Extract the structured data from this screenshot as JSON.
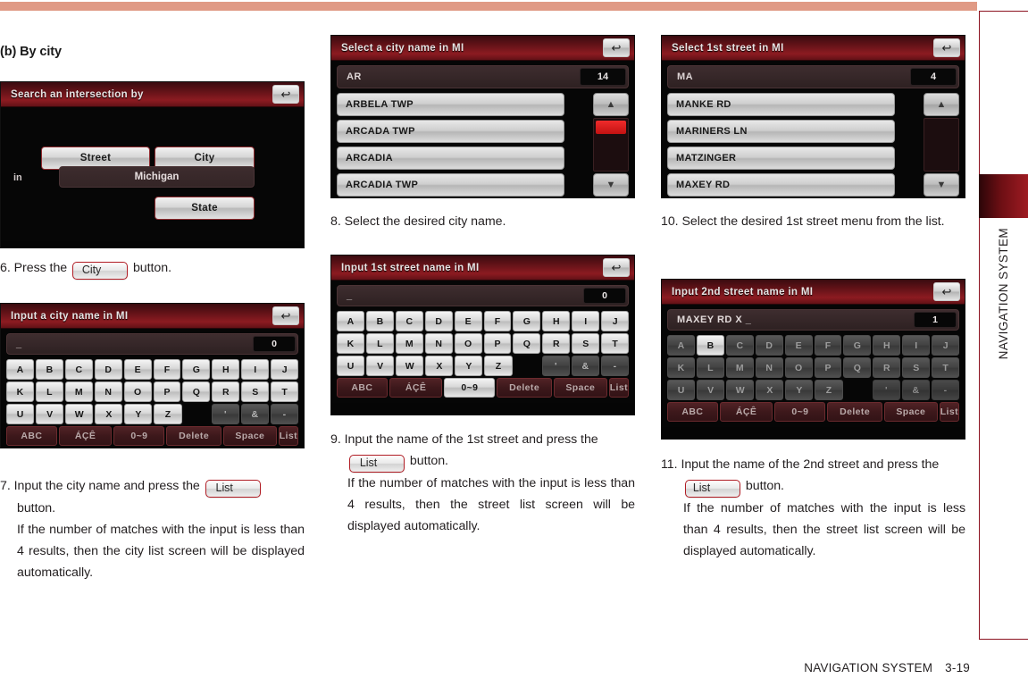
{
  "page": {
    "section_heading": "(b) By city",
    "footer_title": "NAVIGATION SYSTEM",
    "footer_page": "3-19",
    "side_tab_label": "NAVIGATION SYSTEM"
  },
  "search_screen": {
    "title": "Search an intersection by",
    "back_icon": "back-arrow-icon",
    "street_button": "Street",
    "city_button": "City",
    "in_label": "in",
    "state_value": "Michigan",
    "state_button": "State"
  },
  "city_keyboard": {
    "title": "Input a city name in MI",
    "back_icon": "back-arrow-icon",
    "input_value": "_",
    "count": "0",
    "rows": [
      [
        "A",
        "B",
        "C",
        "D",
        "E",
        "F",
        "G",
        "H",
        "I",
        "J"
      ],
      [
        "K",
        "L",
        "M",
        "N",
        "O",
        "P",
        "Q",
        "R",
        "S",
        "T"
      ],
      [
        "U",
        "V",
        "W",
        "X",
        "Y",
        "Z",
        "",
        "'",
        "&",
        "-"
      ]
    ],
    "function_keys": [
      "ABC",
      "ÁÇÊ",
      "0~9",
      "Delete",
      "Space",
      "List"
    ],
    "active_function_key": ""
  },
  "city_list": {
    "title": "Select a city name in MI",
    "back_icon": "back-arrow-icon",
    "query": "AR",
    "count": "14",
    "items": [
      "ARBELA TWP",
      "ARCADA TWP",
      "ARCADIA",
      "ARCADIA TWP"
    ],
    "scroll_up_icon": "scroll-up-icon",
    "scroll_down_icon": "scroll-down-icon"
  },
  "street1_keyboard": {
    "title": "Input 1st street name in MI",
    "back_icon": "back-arrow-icon",
    "input_value": "_",
    "count": "0",
    "rows": [
      [
        "A",
        "B",
        "C",
        "D",
        "E",
        "F",
        "G",
        "H",
        "I",
        "J"
      ],
      [
        "K",
        "L",
        "M",
        "N",
        "O",
        "P",
        "Q",
        "R",
        "S",
        "T"
      ],
      [
        "U",
        "V",
        "W",
        "X",
        "Y",
        "Z",
        "",
        "'",
        "&",
        "-"
      ]
    ],
    "function_keys": [
      "ABC",
      "ÁÇÊ",
      "0~9",
      "Delete",
      "Space",
      "List"
    ],
    "active_function_key": "0~9"
  },
  "street1_list": {
    "title": "Select 1st street in MI",
    "back_icon": "back-arrow-icon",
    "query": "MA",
    "count": "4",
    "items": [
      "MANKE RD",
      "MARINERS LN",
      "MATZINGER",
      "MAXEY RD"
    ],
    "scroll_up_icon": "scroll-up-icon",
    "scroll_down_icon": "scroll-down-icon"
  },
  "street2_keyboard": {
    "title": "Input 2nd street name in MI",
    "back_icon": "back-arrow-icon",
    "input_value": "MAXEY RD X _",
    "count": "1",
    "rows": [
      [
        "A",
        "B",
        "C",
        "D",
        "E",
        "F",
        "G",
        "H",
        "I",
        "J"
      ],
      [
        "K",
        "L",
        "M",
        "N",
        "O",
        "P",
        "Q",
        "R",
        "S",
        "T"
      ],
      [
        "U",
        "V",
        "W",
        "X",
        "Y",
        "Z",
        "",
        "'",
        "&",
        "-"
      ]
    ],
    "function_keys": [
      "ABC",
      "ÁÇÊ",
      "0~9",
      "Delete",
      "Space",
      "List"
    ],
    "active_function_key": "",
    "enabled_letter": "B"
  },
  "steps": {
    "s6": {
      "num": "6.",
      "pre": "Press the",
      "chip": "City",
      "post": "button."
    },
    "s7": {
      "num": "7.",
      "pre": "Input the city name and press the",
      "chip": "List",
      "post": "button.",
      "note": "If the number of matches with the input is less than 4 results, then the city list screen will be displayed automatically."
    },
    "s8": {
      "num": "8.",
      "text": "Select the desired city name."
    },
    "s9": {
      "num": "9.",
      "pre": "Input the name of the 1st street and press the",
      "chip": "List",
      "post": "button.",
      "note": "If the number of matches with the input is less than 4 results, then the street list screen will be displayed automatically."
    },
    "s10": {
      "num": "10.",
      "text": "Select the desired 1st street menu from the list."
    },
    "s11": {
      "num": "11.",
      "pre": "Input the name of the 2nd street and press the",
      "chip": "List",
      "post": "button.",
      "note": "If the number of matches with the input is less than 4 results, then the street list screen will be displayed automatically."
    }
  },
  "colors": {
    "top_band": "#e09a85",
    "rail_border": "#8c1220",
    "chip_border": "#b01c24",
    "title_bar": "#8c1b21",
    "scroll_thumb": "#c21212"
  }
}
